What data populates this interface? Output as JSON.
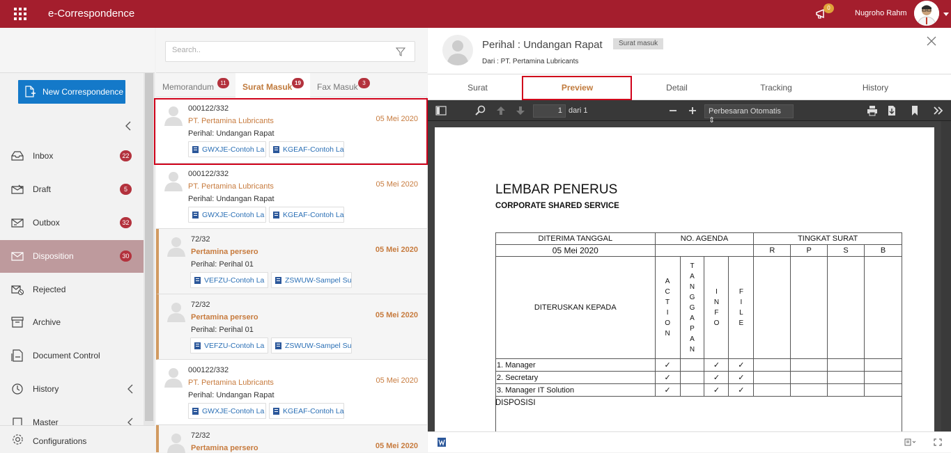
{
  "app": {
    "title": "e-Correspondence",
    "notif_count": "0",
    "user_name": "Nugroho Rahm"
  },
  "sidebar": {
    "new_button": "New Correspondence",
    "items": [
      {
        "label": "Inbox",
        "count": "22"
      },
      {
        "label": "Draft",
        "count": "5"
      },
      {
        "label": "Outbox",
        "count": "32"
      },
      {
        "label": "Disposition",
        "count": "30"
      },
      {
        "label": "Rejected"
      },
      {
        "label": "Archive"
      },
      {
        "label": "Document Control"
      },
      {
        "label": "History"
      },
      {
        "label": "Master"
      }
    ],
    "config": "Configurations"
  },
  "list": {
    "search_placeholder": "Search..",
    "tabs": [
      {
        "label": "Memorandum",
        "count": "11"
      },
      {
        "label": "Surat Masuk",
        "count": "19"
      },
      {
        "label": "Fax Masuk",
        "count": "3"
      }
    ],
    "items": [
      {
        "number": "000122/332",
        "sender": "PT. Pertamina Lubricants",
        "date": "05 Mei 2020",
        "perihal": "Perihal: Undangan Rapat",
        "attachments": [
          "GWXJE-Contoh La",
          "KGEAF-Contoh La"
        ]
      },
      {
        "number": "000122/332",
        "sender": "PT. Pertamina Lubricants",
        "date": "05 Mei 2020",
        "perihal": "Perihal: Undangan Rapat",
        "attachments": [
          "GWXJE-Contoh La",
          "KGEAF-Contoh La"
        ]
      },
      {
        "number": "72/32",
        "sender": "Pertamina persero",
        "date": "05 Mei 2020",
        "perihal": "Perihal: Perihal 01",
        "attachments": [
          "VEFZU-Contoh La",
          "ZSWUW-Sampel Su"
        ]
      },
      {
        "number": "72/32",
        "sender": "Pertamina persero",
        "date": "05 Mei 2020",
        "perihal": "Perihal: Perihal 01",
        "attachments": [
          "VEFZU-Contoh La",
          "ZSWUW-Sampel Su"
        ]
      },
      {
        "number": "000122/332",
        "sender": "PT. Pertamina Lubricants",
        "date": "05 Mei 2020",
        "perihal": "Perihal: Undangan Rapat",
        "attachments": [
          "GWXJE-Contoh La",
          "KGEAF-Contoh La"
        ]
      },
      {
        "number": "72/32",
        "sender": "Pertamina persero",
        "date": "05 Mei 2020",
        "perihal": "",
        "attachments": []
      }
    ]
  },
  "detail": {
    "title": "Perihal : Undangan Rapat",
    "badge": "Surat masuk",
    "from": "Dari : PT. Pertamina Lubricants",
    "tabs": [
      "Surat",
      "Preview",
      "Detail",
      "Tracking",
      "History"
    ]
  },
  "pdf": {
    "page": "1",
    "page_of": "dari 1",
    "zoom": "Perbesaran Otomatis",
    "doc_title": "LEMBAR PENERUS",
    "doc_subtitle": "CORPORATE SHARED SERVICE",
    "col_diterima": "DITERIMA TANGGAL",
    "col_agenda": "NO. AGENDA",
    "col_tingkat": "TINGKAT SURAT",
    "date_val": "05 Mei 2020",
    "levels": [
      "R",
      "P",
      "S",
      "B"
    ],
    "diteruskan": "DITERUSKAN KEPADA",
    "actions": [
      "ACTION",
      "TANGGAPAN",
      "INFO",
      "FILE"
    ],
    "rows": [
      {
        "name": "1. Manager",
        "checks": [
          "✓",
          "",
          "✓",
          "✓"
        ]
      },
      {
        "name": "2. Secretary",
        "checks": [
          "✓",
          "",
          "✓",
          "✓"
        ]
      },
      {
        "name": "3. Manager IT Solution",
        "checks": [
          "✓",
          "",
          "✓",
          "✓"
        ]
      }
    ],
    "disposisi": "DISPOSISI"
  },
  "colors": {
    "brand": "#a41e2d",
    "accent": "#c07a3c",
    "primary_button": "#1479c9",
    "badge": "#b3323d"
  }
}
